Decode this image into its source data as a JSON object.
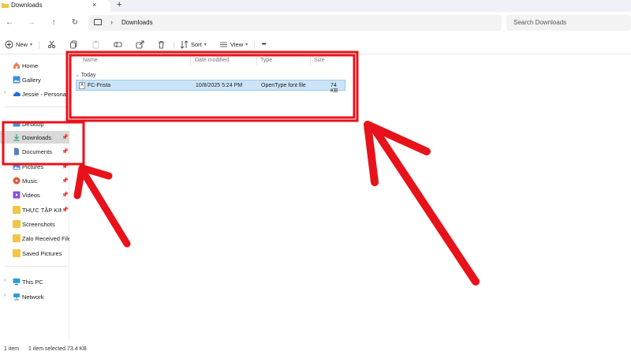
{
  "window": {
    "tab_title": "Downloads",
    "tab_close": "×",
    "new_tab": "+"
  },
  "nav": {
    "back": "←",
    "forward": "→",
    "up": "↑",
    "refresh": "↻"
  },
  "address": {
    "chevron": "›",
    "path": "Downloads"
  },
  "search": {
    "placeholder": "Search Downloads"
  },
  "toolbar": {
    "new_label": "New",
    "sort_label": "Sort",
    "view_label": "View",
    "more_label": "•••"
  },
  "sidebar": {
    "items": [
      {
        "label": "Home",
        "icon": "home-icon"
      },
      {
        "label": "Gallery",
        "icon": "gallery-icon"
      },
      {
        "label": "Jessie - Personal",
        "icon": "cloud-icon"
      },
      {
        "label": "Desktop",
        "icon": "desktop-icon"
      },
      {
        "label": "Downloads",
        "icon": "download-icon",
        "selected": true
      },
      {
        "label": "Documents",
        "icon": "documents-icon"
      },
      {
        "label": "Pictures",
        "icon": "pictures-icon"
      },
      {
        "label": "Music",
        "icon": "music-icon"
      },
      {
        "label": "Videos",
        "icon": "videos-icon"
      },
      {
        "label": "THỰC TẬP KIM I",
        "icon": "folder-icon"
      },
      {
        "label": "Screenshots",
        "icon": "folder-icon"
      },
      {
        "label": "Zalo Received Files",
        "icon": "folder-icon"
      },
      {
        "label": "Saved Pictures",
        "icon": "folder-icon"
      },
      {
        "label": "This PC",
        "icon": "this-pc-icon"
      },
      {
        "label": "Network",
        "icon": "network-icon"
      }
    ]
  },
  "columns": {
    "name": "Name",
    "date": "Date modified",
    "type": "Type",
    "size": "Size"
  },
  "group_label": "Today",
  "files": [
    {
      "name": "FC-Frista",
      "date": "10/8/2025 5:24 PM",
      "type": "OpenType font file",
      "size": "74 KB",
      "icon_text": "A"
    }
  ],
  "status": {
    "count": "1 item",
    "selection": "1 item selected  73.4 KB"
  },
  "colors": {
    "annotation_red": "#e8121a",
    "selection_blue": "#cce4f7",
    "folder_yellow": "#f4c542"
  }
}
